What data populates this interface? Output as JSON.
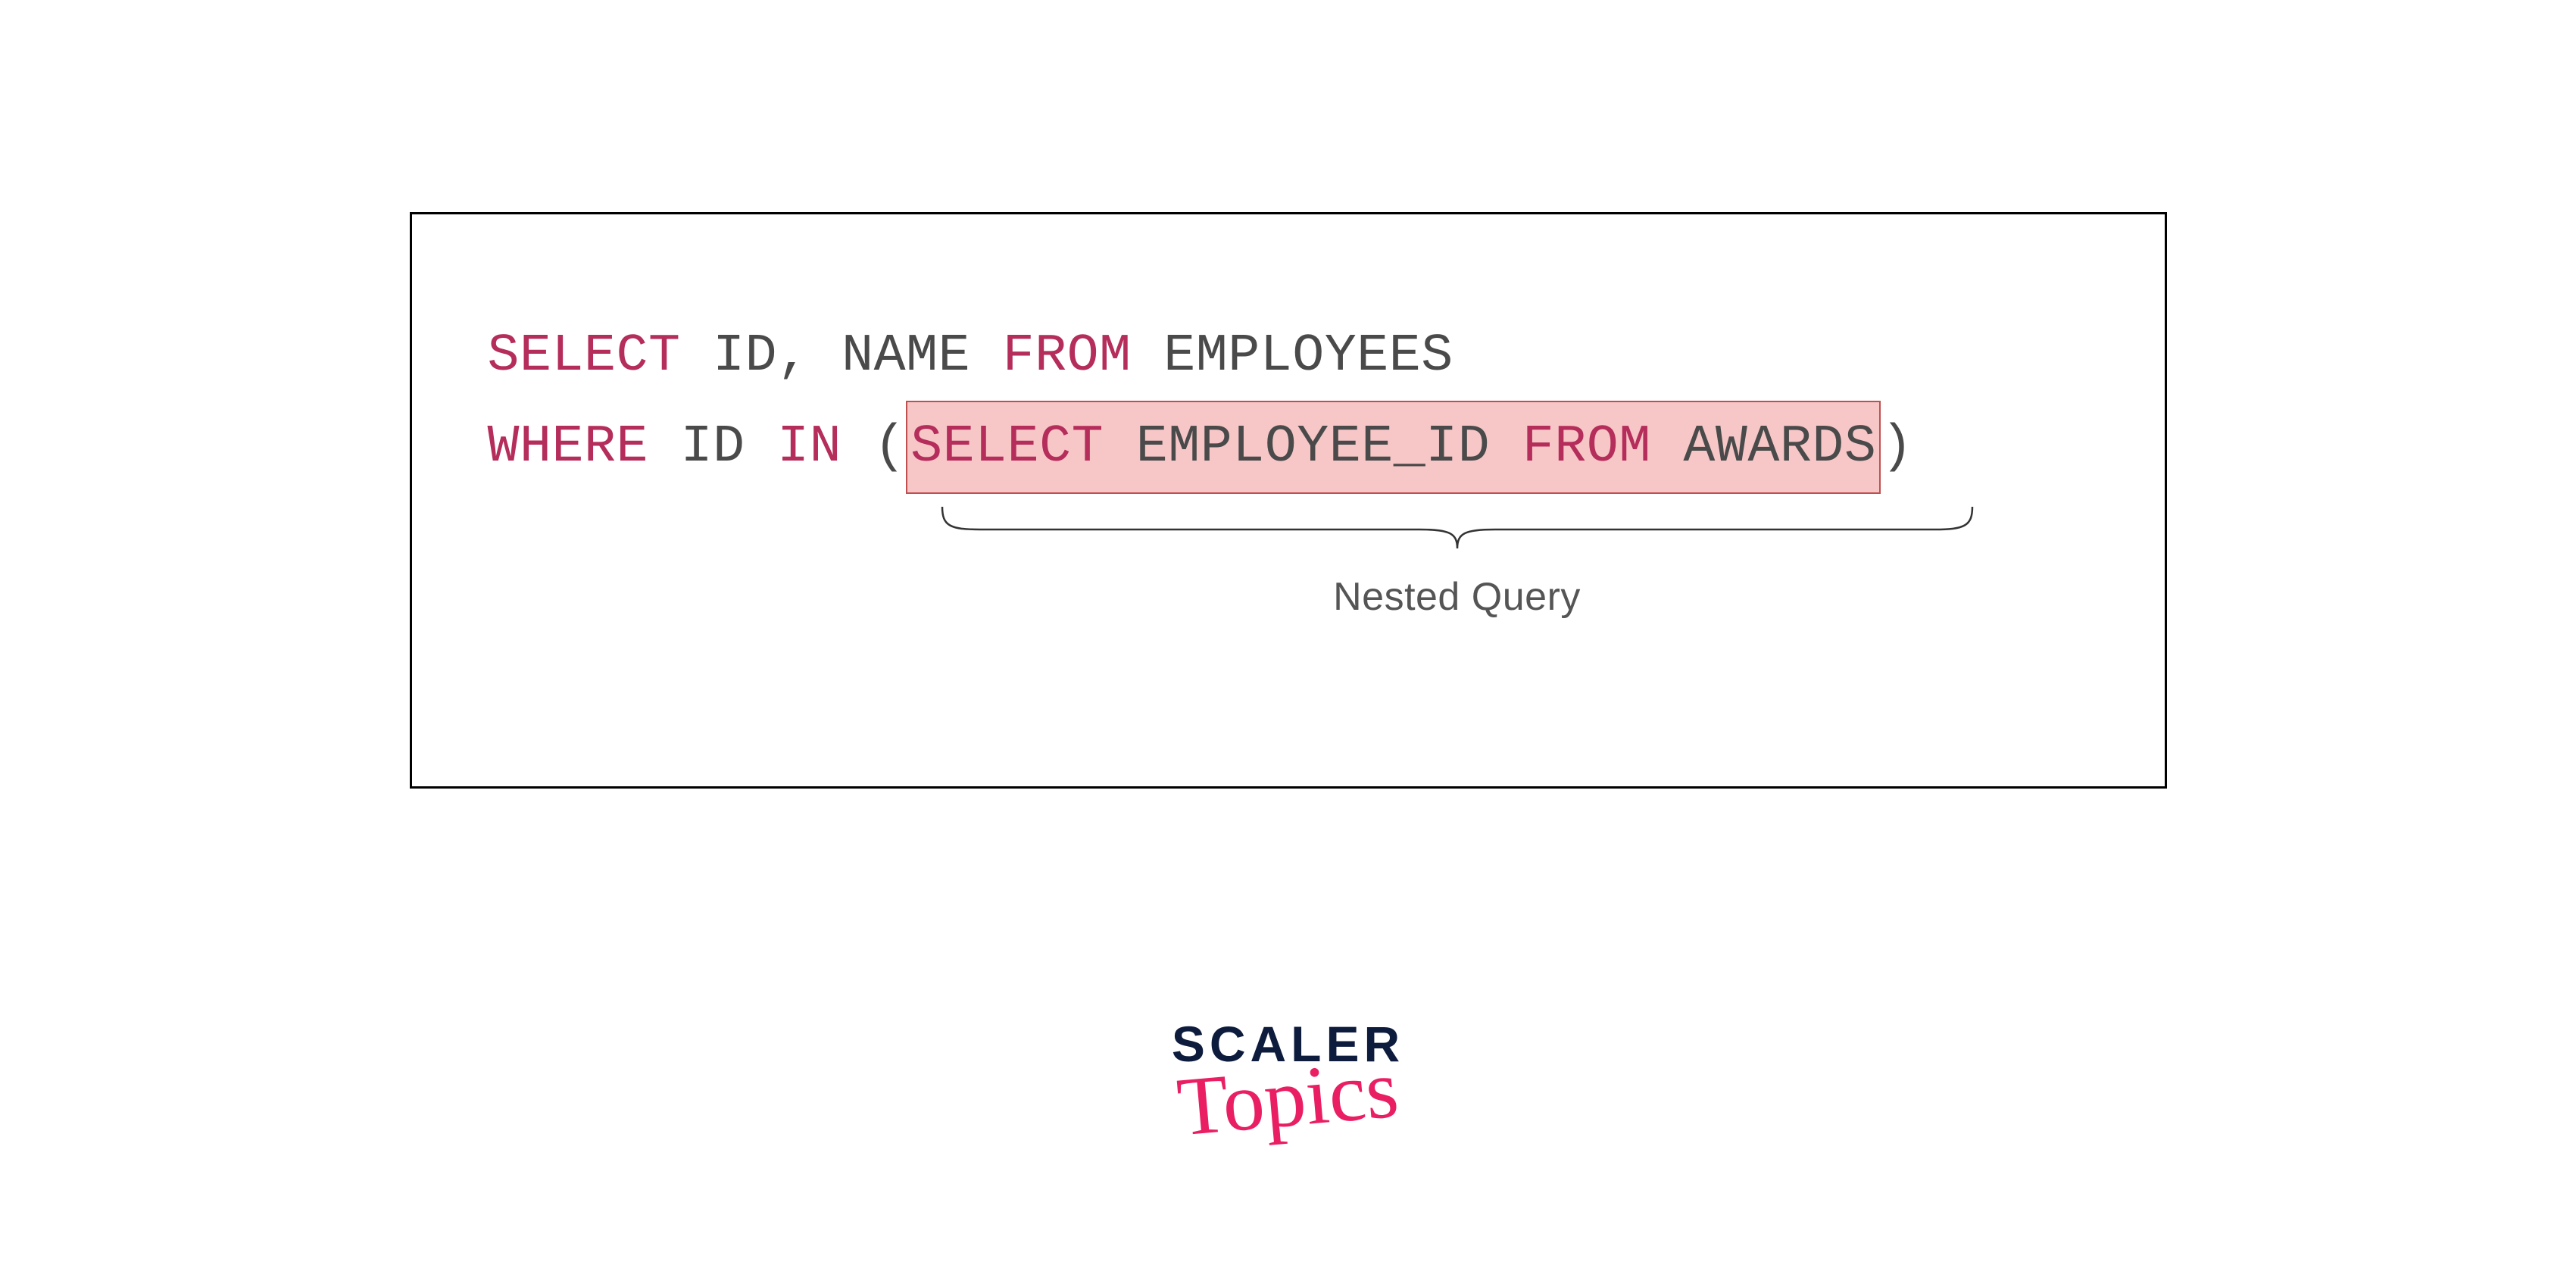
{
  "sql": {
    "line1": {
      "select": "SELECT",
      "cols": "ID, NAME",
      "from": "FROM",
      "table": "EMPLOYEES"
    },
    "line2": {
      "where": "WHERE",
      "col": "ID",
      "in": "IN",
      "open": "(",
      "inner_select": "SELECT",
      "inner_col": "EMPLOYEE_ID",
      "inner_from": "FROM",
      "inner_table": "AWARDS",
      "close": ")"
    }
  },
  "annotation": {
    "label": "Nested Query"
  },
  "logo": {
    "brand": "SCALER",
    "sub": "Topics"
  }
}
